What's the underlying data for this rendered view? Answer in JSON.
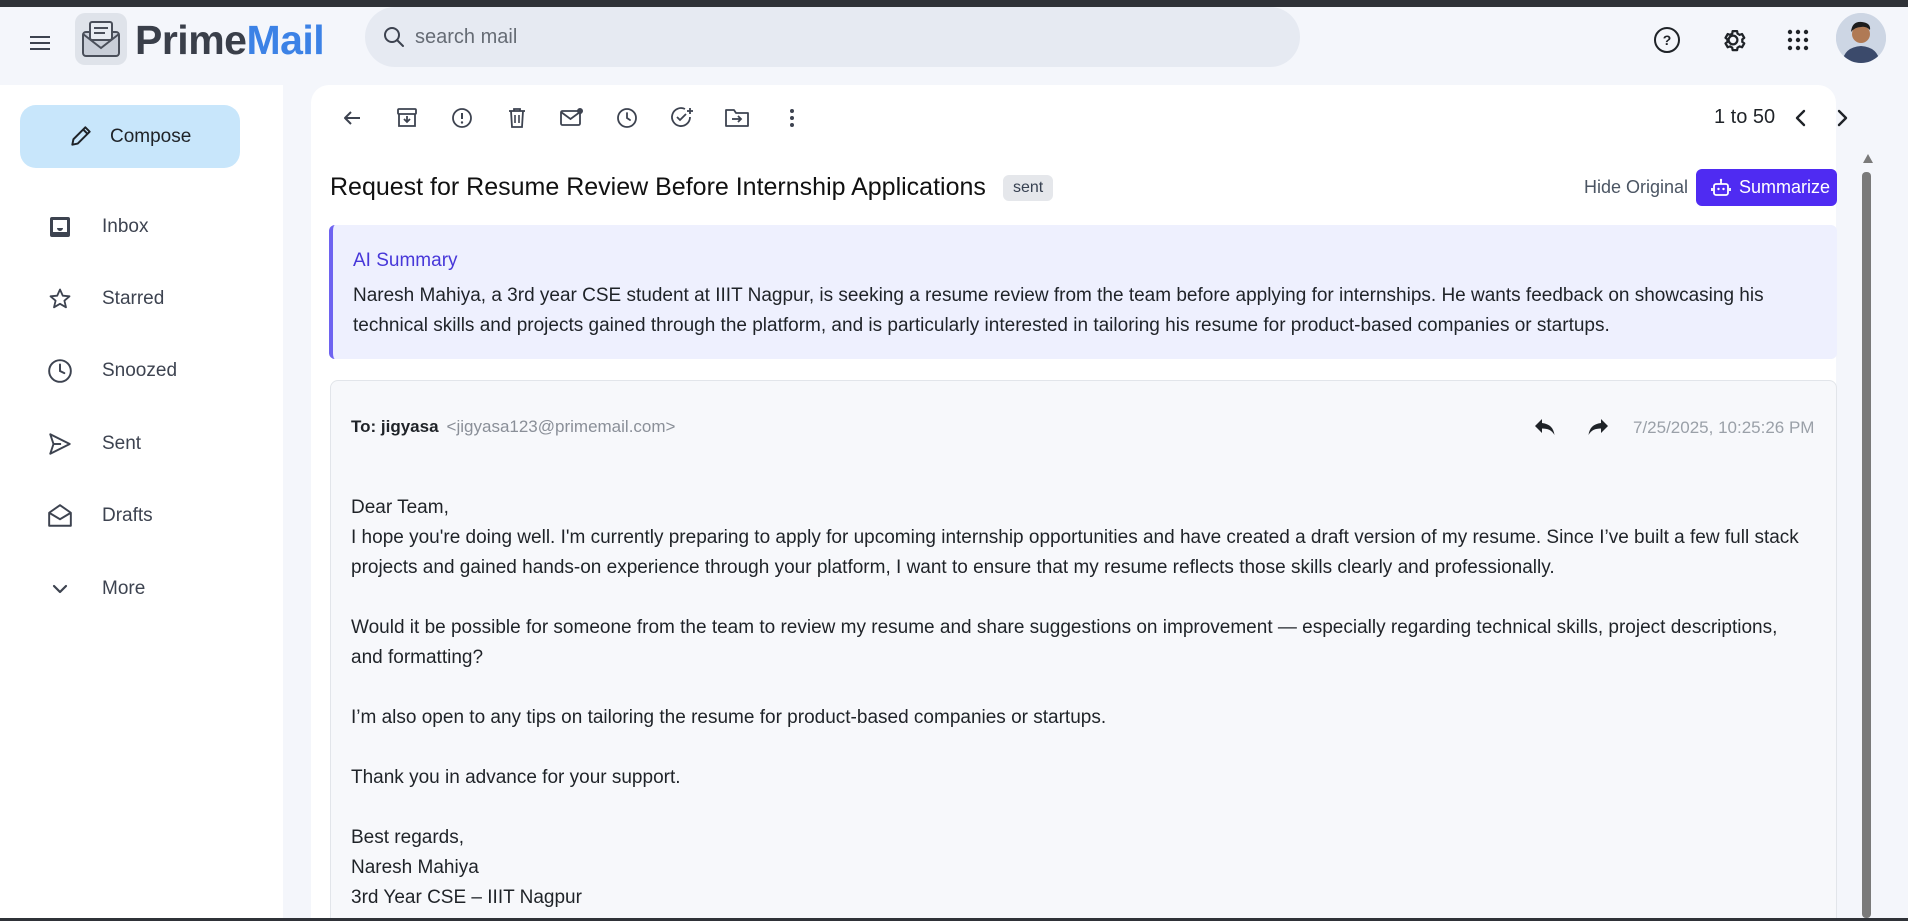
{
  "app": {
    "brand_part1": "Prime",
    "brand_part2": "Mail"
  },
  "search": {
    "placeholder": "search mail"
  },
  "header_icons": [
    "help-icon",
    "settings-icon",
    "apps-grid-icon",
    "avatar"
  ],
  "sidebar": {
    "compose_label": "Compose",
    "items": [
      {
        "label": "Inbox",
        "icon": "inbox-icon"
      },
      {
        "label": "Starred",
        "icon": "star-icon"
      },
      {
        "label": "Snoozed",
        "icon": "clock-icon"
      },
      {
        "label": "Sent",
        "icon": "send-icon"
      },
      {
        "label": "Drafts",
        "icon": "drafts-icon"
      },
      {
        "label": "More",
        "icon": "chevron-down-icon"
      }
    ]
  },
  "toolbar": {
    "icons": [
      "back-arrow-icon",
      "archive-icon",
      "report-spam-icon",
      "delete-icon",
      "mark-unread-icon",
      "snooze-icon",
      "add-task-icon",
      "move-to-icon",
      "more-vert-icon"
    ],
    "pager_text": "1 to 50"
  },
  "email": {
    "subject": "Request for Resume Review Before Internship Applications",
    "label_badge": "sent",
    "hide_original": "Hide Original",
    "summarize_label": "Summarize",
    "ai_summary": {
      "title": "AI Summary",
      "text": "Naresh Mahiya, a 3rd year CSE student at IIIT Nagpur, is seeking a resume review from the team before applying for internships. He wants feedback on showcasing his technical skills and projects gained through the platform, and is particularly interested in tailoring his resume for product-based companies or startups."
    },
    "to_label": "To: jigyasa",
    "to_address": "<jigyasa123@primemail.com>",
    "timestamp": "7/25/2025, 10:25:26 PM",
    "body": {
      "greeting": "Dear Team,",
      "p1": "I hope you're doing well. I'm currently preparing to apply for upcoming internship opportunities and have created a draft version of my resume. Since I’ve built a few full stack projects and gained hands-on experience through your platform, I want to ensure that my resume reflects those skills clearly and professionally.",
      "p2": "Would it be possible for someone from the team to review my resume and share suggestions on improvement — especially regarding technical skills, project descriptions, and formatting?",
      "p3": "I’m also open to any tips on tailoring the resume for product-based companies or startups.",
      "p4": "Thank you in advance for your support.",
      "closing": "Best regards,",
      "name": "Naresh Mahiya",
      "title": "3rd Year CSE – IIIT Nagpur"
    }
  },
  "colors": {
    "accent": "#4f2bf2",
    "brand_blue": "#3c82e6",
    "compose_bg": "#c8e6fb",
    "ai_box_bg": "#eef0fe"
  }
}
